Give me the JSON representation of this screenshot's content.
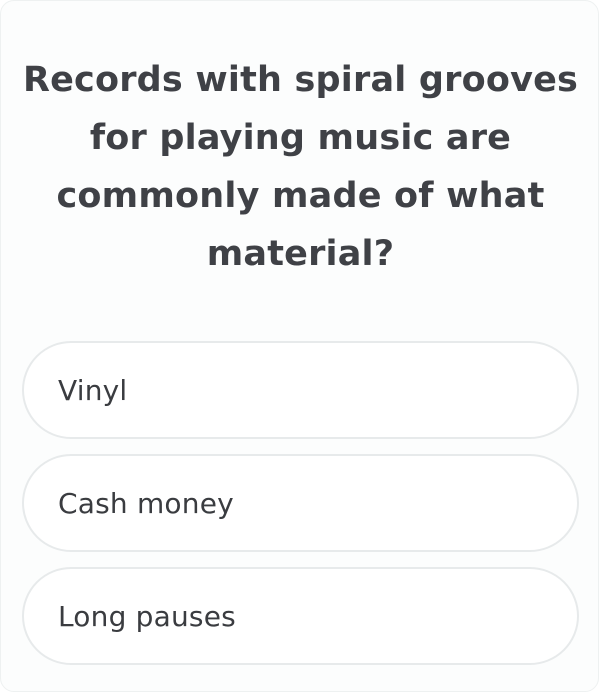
{
  "quiz": {
    "question": "Records with spiral grooves for playing music are commonly made of what material?",
    "answers": [
      {
        "label": "Vinyl"
      },
      {
        "label": "Cash money"
      },
      {
        "label": "Long pauses"
      }
    ]
  }
}
